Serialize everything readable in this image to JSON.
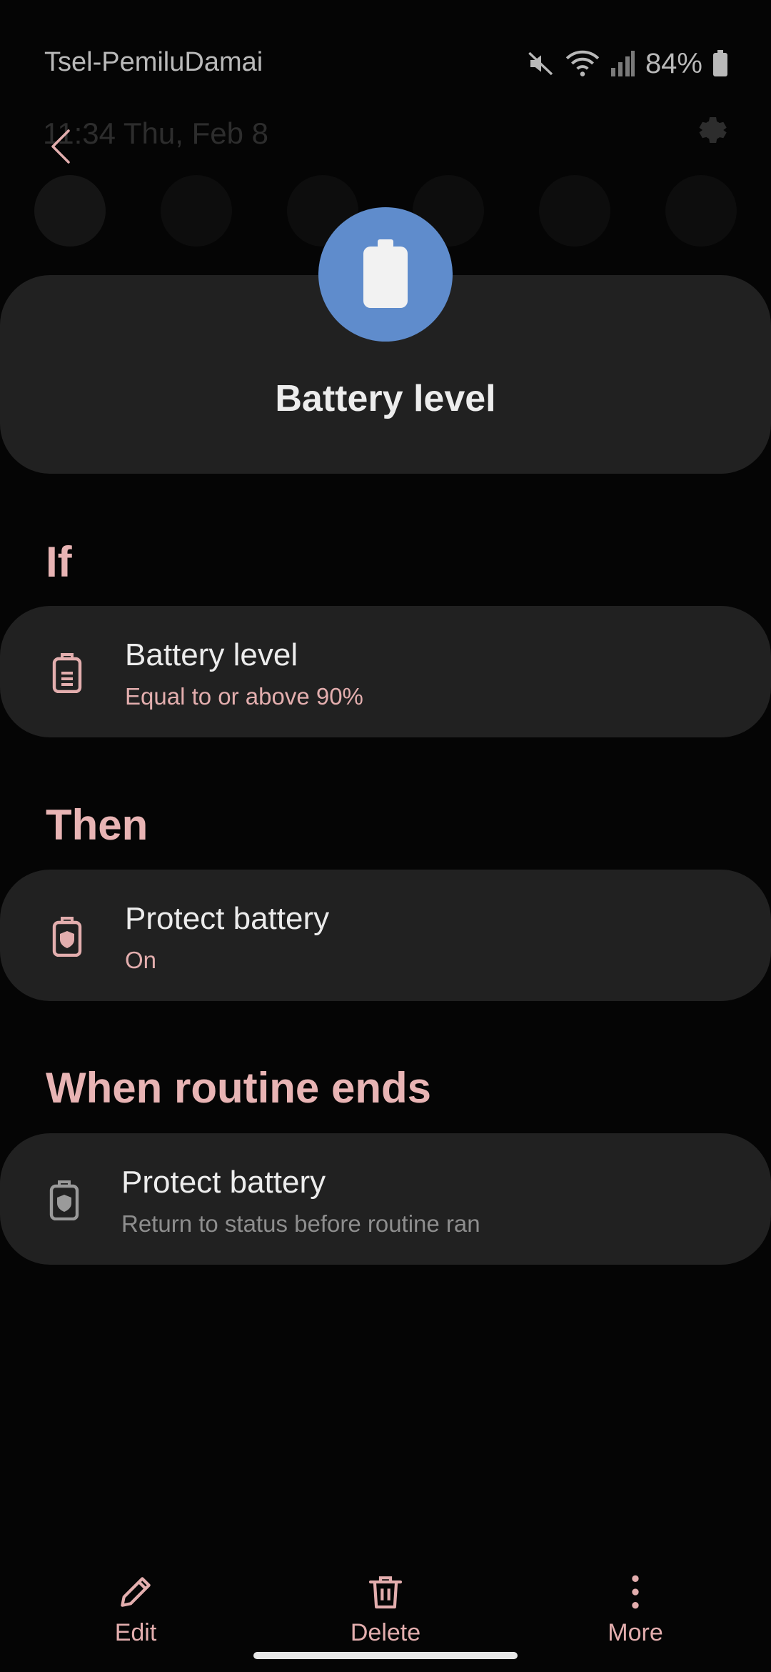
{
  "status_bar": {
    "carrier": "Tsel-PemiluDamai",
    "battery_percent": "84%",
    "icons": [
      "mute-icon",
      "wifi-icon",
      "signal-icon",
      "battery-icon"
    ]
  },
  "background_panel": {
    "time_date": "11:34  Thu, Feb 8",
    "icons": [
      "gear-icon",
      "wifi-icon",
      "data-icon",
      "location-icon",
      "flashlight-icon",
      "bluetooth-icon",
      "sound-icon"
    ]
  },
  "header": {
    "title": "Battery level",
    "icon": "battery-icon",
    "icon_bg": "#5f8ccc"
  },
  "sections": {
    "if_heading": "If",
    "then_heading": "Then",
    "ends_heading": "When routine ends"
  },
  "cards": {
    "if_card": {
      "title": "Battery level",
      "subtitle": "Equal to or above 90%",
      "icon": "battery-level-icon"
    },
    "then_card": {
      "title": "Protect battery",
      "subtitle": "On",
      "icon": "protect-battery-icon"
    },
    "ends_card": {
      "title": "Protect battery",
      "subtitle": "Return to status before routine ran",
      "icon": "protect-battery-icon"
    }
  },
  "bottom_bar": {
    "edit_label": "Edit",
    "delete_label": "Delete",
    "more_label": "More"
  },
  "colors": {
    "accent": "#e3aeae",
    "card_bg": "#212121",
    "background": "#050505"
  }
}
